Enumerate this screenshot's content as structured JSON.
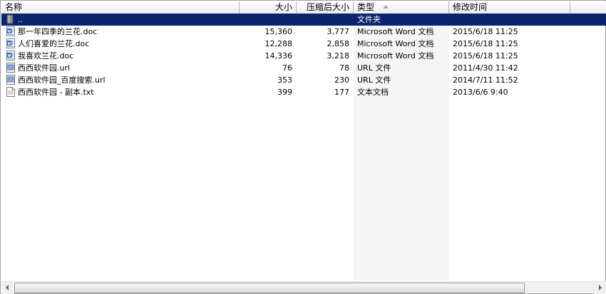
{
  "columns": {
    "name": "名称",
    "size": "大小",
    "compressed_size": "压缩后大小",
    "type": "类型",
    "modified": "修改时间"
  },
  "sorted_column": "type",
  "rows": [
    {
      "name": "..",
      "size": "",
      "compressed_size": "",
      "type": "文件夹",
      "modified": "",
      "icon": "folder-up-icon",
      "selected": true
    },
    {
      "name": "那一年四季的兰花.doc",
      "size": "15,360",
      "compressed_size": "3,777",
      "type": "Microsoft Word 文档",
      "modified": "2015/6/18 11:25",
      "icon": "word-doc-icon",
      "selected": false
    },
    {
      "name": "人们喜爱的兰花.doc",
      "size": "12,288",
      "compressed_size": "2,858",
      "type": "Microsoft Word 文档",
      "modified": "2015/6/18 11:25",
      "icon": "word-doc-icon",
      "selected": false
    },
    {
      "name": "我喜欢兰花.doc",
      "size": "14,336",
      "compressed_size": "3,218",
      "type": "Microsoft Word 文档",
      "modified": "2015/6/18 11:25",
      "icon": "word-doc-icon",
      "selected": false
    },
    {
      "name": "西西软件园.url",
      "size": "76",
      "compressed_size": "78",
      "type": "URL 文件",
      "modified": "2011/4/30 11:42",
      "icon": "url-file-icon",
      "selected": false
    },
    {
      "name": "西西软件园_百度搜索.url",
      "size": "353",
      "compressed_size": "230",
      "type": "URL 文件",
      "modified": "2014/7/11 11:52",
      "icon": "url-file-icon",
      "selected": false
    },
    {
      "name": "西西软件园 - 副本.txt",
      "size": "399",
      "compressed_size": "177",
      "type": "文本文档",
      "modified": "2013/6/6 9:40",
      "icon": "text-file-icon",
      "selected": false
    }
  ],
  "colors": {
    "selection": "#0b2470",
    "header_bg": "#f0f0f0",
    "sorted_column_bg": "#f5f5f5"
  }
}
